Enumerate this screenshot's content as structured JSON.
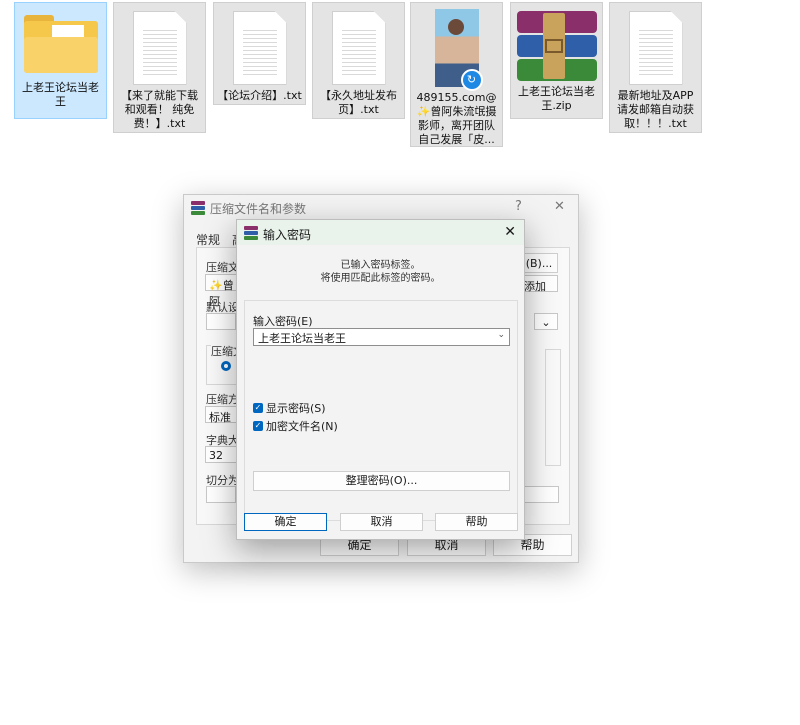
{
  "files": [
    {
      "name": "上老王论坛当老王",
      "icon": "folder-icon",
      "selected": true
    },
    {
      "name": "【来了就能下载和观看！ 纯免费！】.txt",
      "icon": "text-file-icon"
    },
    {
      "name": "【论坛介绍】.txt",
      "icon": "text-file-icon"
    },
    {
      "name": "【永久地址发布页】.txt",
      "icon": "text-file-icon"
    },
    {
      "name": "489155.com@✨曾阿朱流氓摄影师，离开团队自己发展「皮...",
      "icon": "image-thumbnail-icon"
    },
    {
      "name": "上老王论坛当老王.zip",
      "icon": "winrar-archive-icon"
    },
    {
      "name": "最新地址及APP请发邮箱自动获取！！！.txt",
      "icon": "text-file-icon"
    }
  ],
  "back_dialog": {
    "title": "压缩文件名和参数",
    "help_glyph": "?",
    "close_glyph": "✕",
    "tab_general": "常规",
    "tab_advanced_partial": "高",
    "label_archive_name": "压缩文件",
    "archive_name_value": "✨曾阿",
    "browse_button": "(B)...",
    "update_mode_value": "添加",
    "label_default_settings": "默认设",
    "label_archive_format": "压缩文",
    "label_method": "压缩方",
    "method_value": "标准",
    "label_dictionary": "字典大小",
    "dictionary_value": "32",
    "label_split": "切分为分",
    "ok": "确定",
    "cancel": "取消",
    "help": "帮助"
  },
  "password_dialog": {
    "title": "输入密码",
    "close_glyph": "✕",
    "info_line1": "已输入密码标签。",
    "info_line2": "将使用匹配此标签的密码。",
    "label_password": "输入密码(E)",
    "password_value": "上老王论坛当老王",
    "show_password": "显示密码(S)",
    "encrypt_filenames": "加密文件名(N)",
    "organize_button": "整理密码(O)...",
    "ok": "确定",
    "cancel": "取消",
    "help": "帮助"
  },
  "colors": {
    "accent": "#0067c0",
    "selected_bg": "#cce8ff"
  }
}
